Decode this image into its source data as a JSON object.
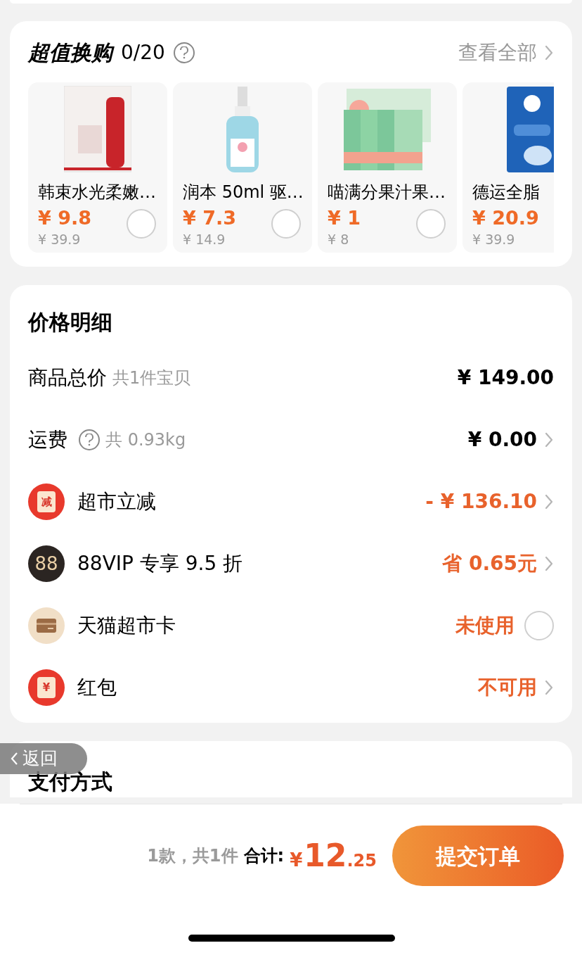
{
  "exchange": {
    "title": "超值换购",
    "count": "0/20",
    "view_all": "查看全部",
    "products": [
      {
        "name": "韩束水光柔嫩…",
        "price": "¥ 9.8",
        "original_price": "¥ 39.9",
        "selected": false,
        "kind": "box"
      },
      {
        "name": "润本 50ml 驱…",
        "price": "¥ 7.3",
        "original_price": "¥ 14.9",
        "selected": false,
        "kind": "bottle"
      },
      {
        "name": "喵满分果汁果…",
        "price": "¥ 1",
        "original_price": "¥ 8",
        "selected": false,
        "kind": "bags"
      },
      {
        "name": "德运全脂",
        "price": "¥ 20.9",
        "original_price": "¥ 39.9",
        "kind": "pack"
      }
    ]
  },
  "price_detail": {
    "title": "价格明细",
    "rows": [
      {
        "kind": "plain",
        "label": "商品总价",
        "note": "共1件宝贝",
        "value": "¥ 149.00",
        "highlight": false,
        "chevron": false
      },
      {
        "kind": "plain",
        "label": "运费",
        "help": true,
        "note": "共 0.93kg",
        "value": "¥ 0.00",
        "highlight": false,
        "chevron": true
      },
      {
        "kind": "coupon",
        "icon_text": "减",
        "label": "超市立减",
        "value": "- ¥ 136.10",
        "highlight": true,
        "chevron": true
      },
      {
        "kind": "vip",
        "icon_text": "88",
        "label": "88VIP 专享 9.5 折",
        "value": "省 0.65元",
        "highlight": true,
        "chevron": true
      },
      {
        "kind": "card",
        "label": "天猫超市卡",
        "value": "未使用",
        "highlight": true,
        "checked": false
      },
      {
        "kind": "coupon",
        "icon_text": "¥",
        "label": "红包",
        "value": "不可用",
        "highlight": true,
        "chevron": true
      }
    ]
  },
  "payment": {
    "title": "支付方式"
  },
  "back_button": "返回",
  "footer": {
    "summary": "1款，共1件",
    "total_label": "合计:",
    "currency": "¥",
    "total_int": "12",
    "total_dec": ".25",
    "submit": "提交订单"
  }
}
